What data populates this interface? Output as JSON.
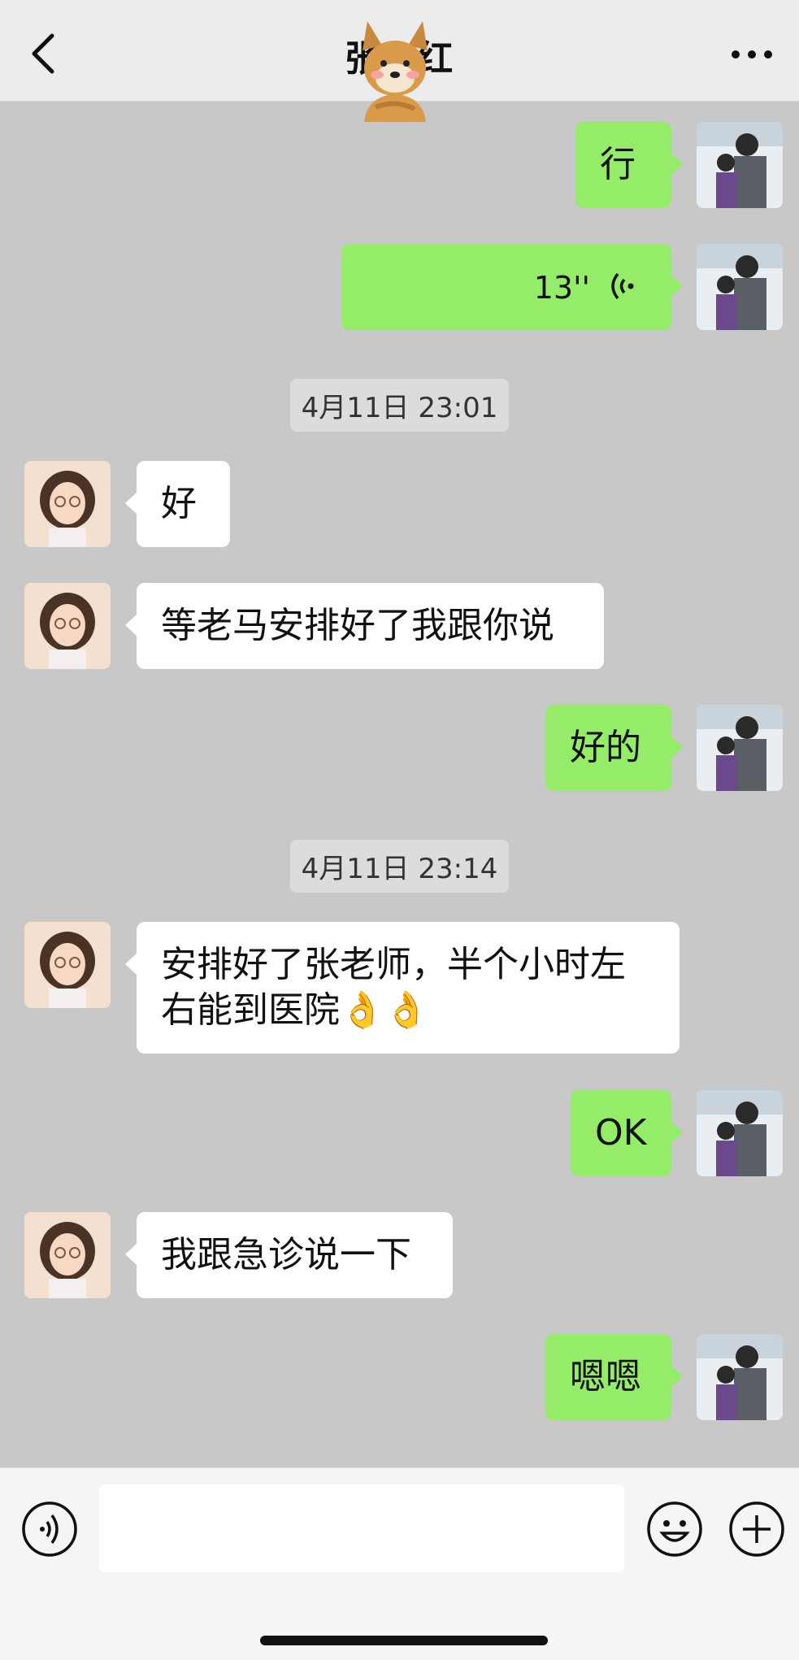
{
  "header": {
    "title": "张□红",
    "back_icon": "chevron-left-icon",
    "more_icon": "more-dots-icon",
    "sticker_icon": "shiba-dog-sticker-icon"
  },
  "messages": [
    {
      "from": "me",
      "type": "text",
      "text": "行"
    },
    {
      "from": "me",
      "type": "voice",
      "duration": "13''",
      "icon": "voice-wave-icon"
    },
    {
      "type": "timestamp",
      "text": "4月11日 23:01"
    },
    {
      "from": "her",
      "type": "text",
      "text": "好"
    },
    {
      "from": "her",
      "type": "text",
      "text": "等老马安排好了我跟你说"
    },
    {
      "from": "me",
      "type": "text",
      "text": "好的"
    },
    {
      "type": "timestamp",
      "text": "4月11日 23:14"
    },
    {
      "from": "her",
      "type": "text",
      "text": "安排好了张老师，半个小时左右能到医院👌👌"
    },
    {
      "from": "me",
      "type": "text",
      "text": "OK"
    },
    {
      "from": "her",
      "type": "text",
      "text": "我跟急诊说一下"
    },
    {
      "from": "me",
      "type": "text",
      "text": "嗯嗯"
    }
  ],
  "input_bar": {
    "placeholder": "",
    "voice_icon": "voice-input-icon",
    "emoji_icon": "emoji-icon",
    "plus_icon": "plus-icon"
  },
  "colors": {
    "my_bubble": "#95ec69",
    "her_bubble": "#ffffff",
    "background": "#c8c8c8"
  }
}
